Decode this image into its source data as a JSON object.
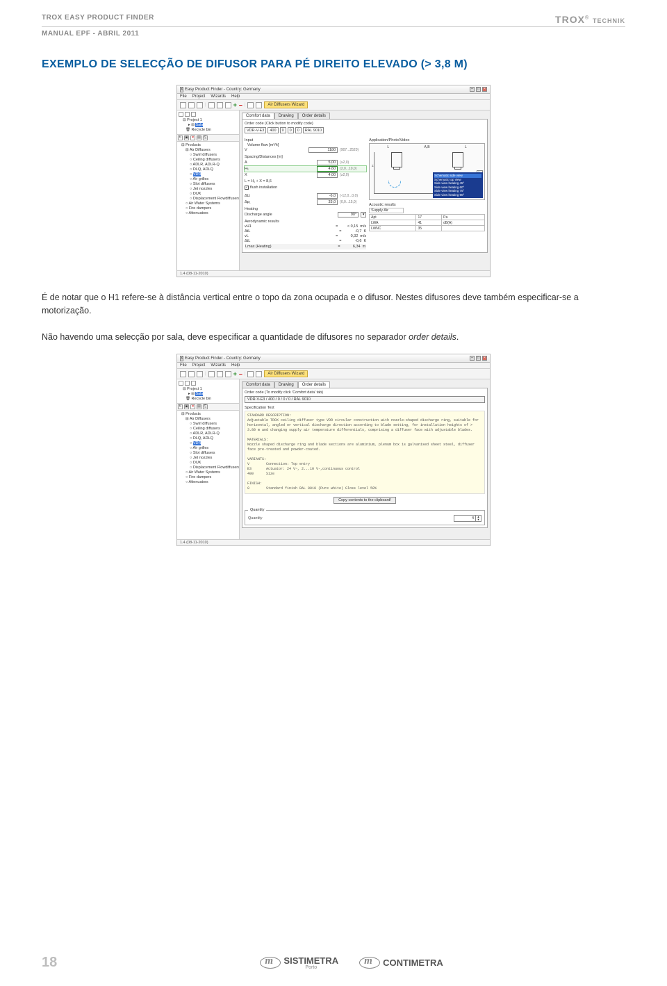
{
  "header": {
    "product": "TROX EASY PRODUCT FINDER",
    "brand": "TROX",
    "brand_suffix": "TECHNIK",
    "subtitle": "MANUAL EPF - ABRIL 2011"
  },
  "section_title": "EXEMPLO DE SELECÇÃO DE DIFUSOR PARA PÉ DIREITO ELEVADO (> 3,8 M)",
  "screenshot1": {
    "window_title": "Easy Product Finder - Country: Germany",
    "menu": [
      "File",
      "Project",
      "Wizards",
      "Help"
    ],
    "wizard_button": "Air Diffusers Wizard",
    "project_tree": {
      "items": [
        "Project 1",
        "Sala",
        "Recycle bin"
      ],
      "selected": "Sala"
    },
    "product_tree": {
      "root": "Products",
      "items": [
        {
          "label": "Air Diffusers",
          "children": [
            {
              "label": "Swirl diffusers"
            },
            {
              "label": "Ceiling diffusers"
            },
            {
              "label": "ADLR, ADLR-Q"
            },
            {
              "label": "DLQ, ADLQ"
            },
            {
              "label": "VDR",
              "selected": true
            },
            {
              "label": "Air grilles"
            },
            {
              "label": "Slot diffusers"
            },
            {
              "label": "Jet nozzles"
            },
            {
              "label": "DUK"
            },
            {
              "label": "Displacement Flowdiffusers"
            }
          ]
        },
        {
          "label": "Air Water Systems"
        },
        {
          "label": "Fire dampers"
        },
        {
          "label": "Attenuators"
        }
      ]
    },
    "tabs": [
      "Comfort data",
      "Drawing",
      "Order details"
    ],
    "active_tab": "Comfort data",
    "order_label": "Order code (Click button to modify code)",
    "order_parts": [
      "VDR-V-E3",
      "400",
      "0",
      "0",
      "0",
      "RAL 9010"
    ],
    "input_section": "Input",
    "vol_label": "Volume flow [m³/h]",
    "vol_sym": "V",
    "vol_val": "1180",
    "vol_range": "(907...2520)",
    "spacing_label": "Spacing/Distances [m]",
    "rows": [
      {
        "sym": "A",
        "val": "5,00",
        "range": "(≥2,0)"
      },
      {
        "sym": "H₁",
        "val": "4,60",
        "range": "(2,0...10,0)",
        "hl": true
      },
      {
        "sym": "X",
        "val": "4,00",
        "range": "(≥2,0)"
      }
    ],
    "l_formula": "L = H₁ + X = 8,6",
    "flush": "flush installation",
    "dt_rows": [
      {
        "sym": "Δtz",
        "val": "-6,0",
        "range": "(-12,0...0,0)"
      },
      {
        "sym": "Δp₁",
        "val": "33,0",
        "range": "(0,0...15,0)"
      }
    ],
    "heating_label": "Heating",
    "discharge_label": "Discharge angle",
    "discharge_val": "90°",
    "aero_label": "Aerodynamic results",
    "aero_rows": [
      {
        "s": "vH1",
        "v": "< 0,15",
        "u": "m/s"
      },
      {
        "s": "ΔtL",
        "v": "-0,7",
        "u": "K"
      },
      {
        "s": "vL",
        "v": "0,32",
        "u": "m/s"
      },
      {
        "s": "ΔtL",
        "v": "-0,6",
        "u": "K"
      }
    ],
    "lmax_label": "Lmax (Heating)",
    "lmax_val": "6,34",
    "lmax_u": "m",
    "app_label": "Application/Photo/Video",
    "diagram_top": [
      "L",
      "A,B",
      "L"
    ],
    "popup_lines": [
      "Schematic side view",
      "Schematic top view",
      "Side view heating 45°",
      "Side view heating 60°",
      "Side view heating 75°",
      "Side view heating 90°"
    ],
    "ac_label": "Acoustic results",
    "ac_supply": "Supply Air",
    "ac_rows": [
      {
        "n": "Δpt",
        "v": "17",
        "u": "Pa"
      },
      {
        "n": "LWA",
        "v": "41",
        "u": "dB(A)"
      },
      {
        "n": "LWNC",
        "v": "35",
        "u": ""
      }
    ],
    "status": "1.4 (08-11-2010)"
  },
  "paragraph1": "É de notar que o H1 refere-se à distância vertical entre o topo da zona ocupada e o difusor. Nestes difusores deve também especificar-se a motorização.",
  "paragraph2_a": "Não havendo uma selecção por sala, deve especificar a quantidade de difusores no separador ",
  "paragraph2_em": "order details",
  "paragraph2_b": ".",
  "screenshot2": {
    "window_title": "Easy Product Finder - Country: Germany",
    "menu": [
      "File",
      "Project",
      "Wizards",
      "Help"
    ],
    "wizard_button": "Air Diffusers Wizard",
    "active_tab": "Order details",
    "tabs": [
      "Comfort data",
      "Drawing",
      "Order details"
    ],
    "order_label": "Order code (To modify click 'Comfort data' tab)",
    "order_string": "VDR-V-E3 / 400 / 0 / 0 / 0 / RAL 9010",
    "spec_title": "Specification Text",
    "spec_text": "STANDARD DESCRIPTION:\nAdjustable TROX ceiling diffuser type VDR circular construction with nozzle-shaped discharge ring, suitable for horizontal, angled or vertical discharge direction according to blade setting, for installation heights of > 3.80 m and changing supply air temperature differentials, comprising a diffuser face with adjustable blades.\n\nMATERIALS:\nNozzle shaped discharge ring and blade sections are aluminium, plenum box is galvanised sheet steel, diffuser face pre-treated and powder-coated.\n\nVARIANTS:\nV        Connection: Top entry\nE3       Actuator: 24 V~, 2...10 V-,continuous control\n400      Size\n\nFINISH:\n0        Standard finish RAL 9010 (Pure white) Gloss level 50%",
    "copy_button": "Copy contents to the clipboard!",
    "qty_group": "Quantity",
    "qty_label": "Quantity",
    "qty_value": "4",
    "status": "1.4 (08-11-2010)"
  },
  "footer": {
    "page": "18",
    "logo1": "SISTIMETRA",
    "logo1_sub": "Porto",
    "logo2": "CONTIMETRA"
  }
}
